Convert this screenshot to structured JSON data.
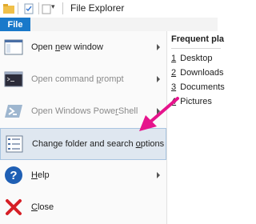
{
  "window": {
    "title": "File Explorer",
    "qat_dropdown": "▾"
  },
  "ribbon": {
    "file_tab": "File"
  },
  "menu": {
    "items": [
      {
        "pre": "Open ",
        "key": "n",
        "post": "ew window",
        "enabled": true,
        "submenu": true,
        "icon": "new-window-icon"
      },
      {
        "pre": "Open command ",
        "key": "p",
        "post": "rompt",
        "enabled": false,
        "submenu": true,
        "icon": "command-prompt-icon"
      },
      {
        "pre": "Open Windows Powe",
        "key": "r",
        "post": "Shell",
        "enabled": false,
        "submenu": true,
        "icon": "powershell-icon"
      },
      {
        "pre": "Change folder and search ",
        "key": "o",
        "post": "ptions",
        "enabled": true,
        "submenu": false,
        "icon": "folder-options-icon",
        "highlighted": true
      },
      {
        "pre": "",
        "key": "H",
        "post": "elp",
        "enabled": true,
        "submenu": true,
        "icon": "help-icon"
      },
      {
        "pre": "",
        "key": "C",
        "post": "lose",
        "enabled": true,
        "submenu": false,
        "icon": "close-icon"
      }
    ]
  },
  "recent": {
    "header": "Frequent pla",
    "items": [
      {
        "num": "1",
        "label": "Desktop"
      },
      {
        "num": "2",
        "label": "Downloads"
      },
      {
        "num": "3",
        "label": "Documents"
      },
      {
        "num": "4",
        "label": "Pictures"
      }
    ]
  },
  "colors": {
    "accent": "#1979ca",
    "annotation_arrow": "#e6148c",
    "highlight_bg": "#dfe7f0"
  }
}
